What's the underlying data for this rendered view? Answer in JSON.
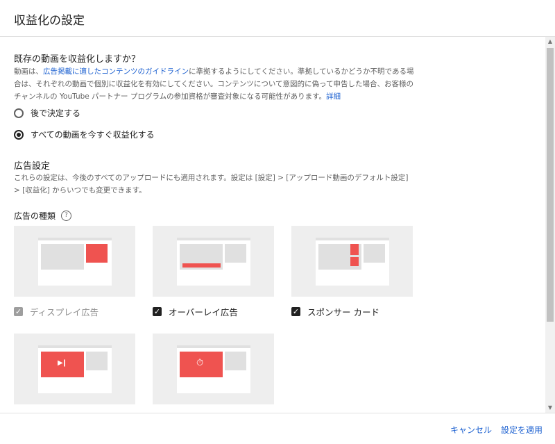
{
  "dialog": {
    "title": "収益化の設定"
  },
  "question": {
    "title": "既存の動画を収益化しますか？",
    "desc_pre": "動画は、",
    "desc_link": "広告掲載に適したコンテンツのガイドライン",
    "desc_mid": "に準拠するようにしてください。準拠しているかどうか不明である場合は、それぞれの動画で個別に収益化を有効にしてください。コンテンツについて意図的に偽って申告した場合、お客様のチャンネルの YouTube パートナー プログラムの参加資格が審査対象になる可能性があります。",
    "desc_more": "詳細"
  },
  "radios": [
    {
      "label": "後で決定する",
      "checked": false
    },
    {
      "label": "すべての動画を今すぐ収益化する",
      "checked": true
    }
  ],
  "ad_settings": {
    "title": "広告設定",
    "desc": "これらの設定は、今後のすべてのアップロードにも適用されます。設定は [設定] > [アップロード動画のデフォルト設定] > [収益化] からいつでも変更できます。"
  },
  "ad_types": {
    "label": "広告の種類",
    "help_icon": "?",
    "items": [
      {
        "label": "ディスプレイ広告",
        "checked": true,
        "disabled": true
      },
      {
        "label": "オーバーレイ広告",
        "checked": true,
        "disabled": false
      },
      {
        "label": "スポンサー カード",
        "checked": true,
        "disabled": false
      },
      {
        "label": "",
        "checked": false,
        "disabled": false
      },
      {
        "label": "",
        "checked": false,
        "disabled": false
      }
    ]
  },
  "icons": {
    "check": "✓",
    "skip": "▶❙",
    "timer": "⏱",
    "scroll_up": "▲",
    "scroll_down": "▼"
  },
  "footer": {
    "cancel": "キャンセル",
    "apply": "設定を適用"
  },
  "colors": {
    "accent": "#1a5fd0",
    "ad_red": "#ef5350"
  }
}
